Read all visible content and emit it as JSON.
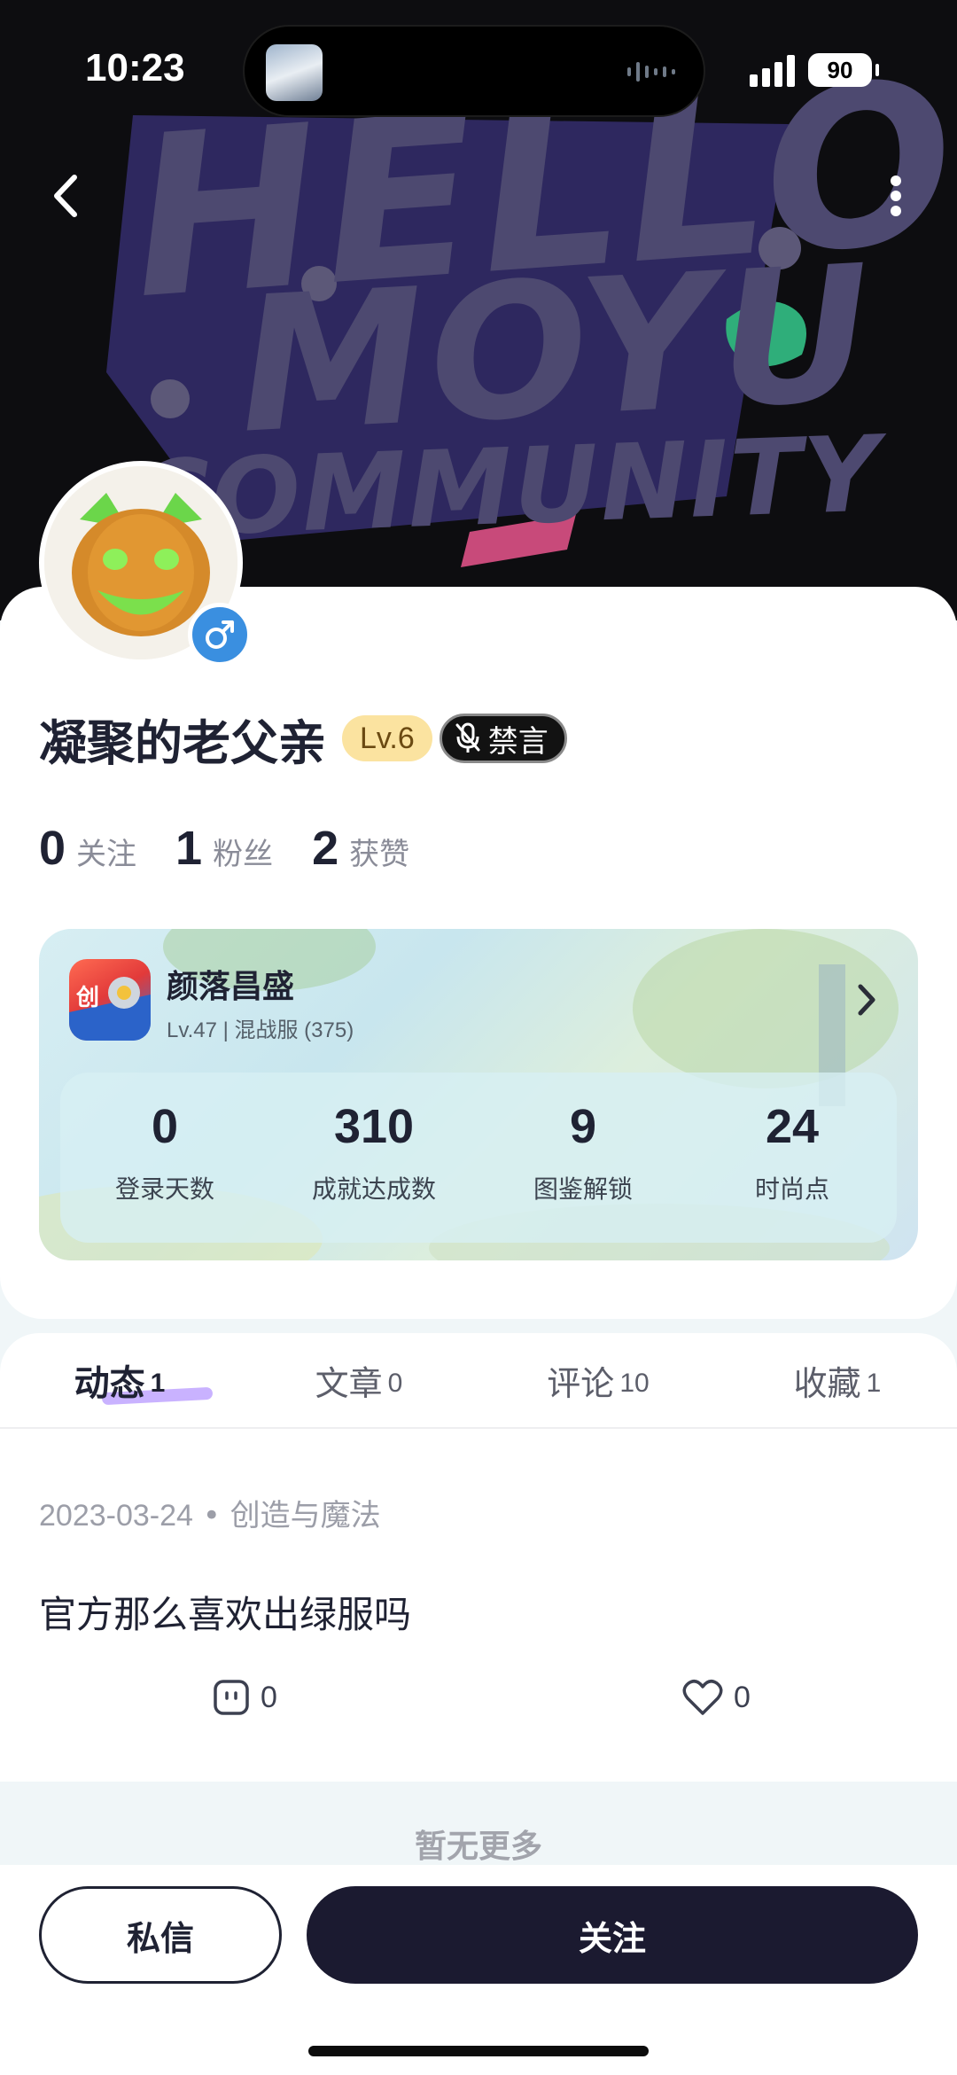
{
  "status_bar": {
    "time": "10:23",
    "battery": "90"
  },
  "header": {
    "banner_lines": [
      "HELLO",
      "MOYU",
      "COMMUNITY"
    ]
  },
  "profile": {
    "username": "凝聚的老父亲",
    "level": "Lv.6",
    "mute_label": "禁言",
    "stats": [
      {
        "value": "0",
        "label": "关注"
      },
      {
        "value": "1",
        "label": "粉丝"
      },
      {
        "value": "2",
        "label": "获赞"
      }
    ]
  },
  "game_card": {
    "role_name": "颜落昌盛",
    "role_info": "Lv.47 | 混战服 (375)",
    "stats": [
      {
        "value": "0",
        "label": "登录天数"
      },
      {
        "value": "310",
        "label": "成就达成数"
      },
      {
        "value": "9",
        "label": "图鉴解锁"
      },
      {
        "value": "24",
        "label": "时尚点"
      }
    ]
  },
  "tabs": [
    {
      "label": "动态",
      "count": "1",
      "active": true
    },
    {
      "label": "文章",
      "count": "0",
      "active": false
    },
    {
      "label": "评论",
      "count": "10",
      "active": false
    },
    {
      "label": "收藏",
      "count": "1",
      "active": false
    }
  ],
  "post": {
    "date": "2023-03-24",
    "separator": "•",
    "game": "创造与魔法",
    "text": "官方那么喜欢出绿服吗",
    "comment_count": "0",
    "like_count": "0"
  },
  "feed_end_text": "暂无更多",
  "bottom_bar": {
    "message_label": "私信",
    "follow_label": "关注"
  },
  "colors": {
    "primary_dark": "#1b1a30",
    "level_badge": "#fbe3a0",
    "gender_badge": "#3a8fe0",
    "tab_underline": "#c9b2ff"
  }
}
